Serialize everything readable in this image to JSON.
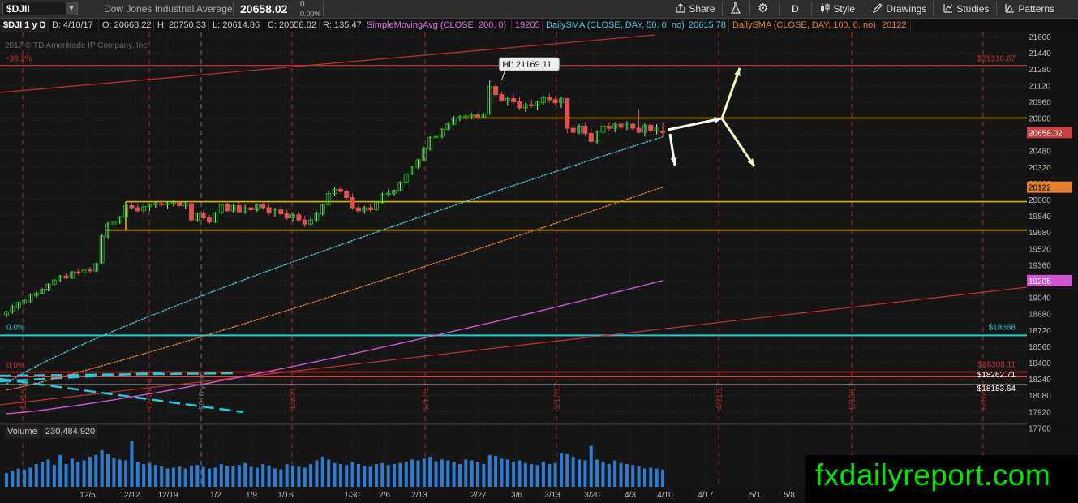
{
  "toolbar": {
    "symbol": "$DJII",
    "description": "Dow Jones Industrial Average",
    "last": "20658.02",
    "change": "0",
    "change_pct": "0.00%",
    "share": "Share",
    "period": "D",
    "style": "Style",
    "drawings": "Drawings",
    "studies": "Studies",
    "patterns": "Patterns"
  },
  "infobar": {
    "title": "$DJI 1 y D",
    "date": "D: 4/10/17",
    "open": "O: 20668.22",
    "high": "H: 20750.33",
    "low": "L: 20614.86",
    "close": "C: 20658.02",
    "range": "R: 135.47",
    "sma200": "SimpleMovingAvg (CLOSE, 200, 0)",
    "sma200_val": "19205",
    "sma50": "DailySMA (CLOSE, DAY, 50, 0, no)",
    "sma50_val": "20615.78",
    "sma100": "DailySMA (CLOSE, DAY, 100, 0, no)",
    "sma100_val": "20122"
  },
  "copyright": "2017 © TD Ameritrade IP Company, Inc.",
  "colors": {
    "up": "#00c000",
    "down": "#e05050",
    "sma50": "#46c8dc",
    "sma100": "#e08030",
    "sma200": "#d055d0",
    "support": "#e0b000",
    "cyan_level": "#20c8e0",
    "fib": "#c83030"
  },
  "price_axis": {
    "ticks": [
      "21600",
      "21440",
      "21280",
      "21120",
      "20960",
      "20800",
      "20640",
      "20480",
      "20320",
      "20160",
      "20000",
      "19840",
      "19680",
      "19520",
      "19360",
      "19200",
      "19040",
      "18880",
      "18720",
      "18560",
      "18400",
      "18240",
      "18080",
      "17920",
      "17760"
    ]
  },
  "badges": {
    "last": "20658.02",
    "sma100": "20122",
    "sma200": "19205"
  },
  "annotations": {
    "hi_callout": "Hi: 21169.11",
    "fib_top_left": "-38.2%",
    "fib_top_right": "$21316.67",
    "fib_zero_cyan": "0.0%",
    "cyan_right": "$18668",
    "fib_zero_red": "0.0%",
    "level_a": "$18262.71",
    "level_b": "$18183.64",
    "level_c": "$18308.11"
  },
  "x_axis": {
    "labels": [
      "12/5",
      "12/12",
      "12/19",
      "1/2",
      "1/9",
      "1/16",
      "1/30",
      "2/6",
      "2/13",
      "2/27",
      "3/6",
      "3/13",
      "3/20",
      "4/3",
      "4/10",
      "4/17",
      "5/1",
      "5/8"
    ]
  },
  "vertical_markers": [
    "12/1/16",
    "12/16/16",
    "2016 year",
    "1/20/17",
    "2/17/17",
    "3/17/17",
    "4/21/17",
    "5/19/17",
    "6/16/17"
  ],
  "volume": {
    "label": "Volume",
    "value": "230,484,920"
  },
  "watermark": "fxdailyreport.com",
  "chart_data": {
    "type": "candlestick",
    "title": "$DJI 1 y D",
    "ylim": [
      17700,
      21680
    ],
    "grid": true,
    "candles": [
      [
        18870,
        18910,
        18840,
        18900
      ],
      [
        18900,
        18970,
        18880,
        18950
      ],
      [
        18940,
        19000,
        18920,
        18990
      ],
      [
        18990,
        19030,
        18970,
        19010
      ],
      [
        19000,
        19080,
        18990,
        19060
      ],
      [
        19060,
        19100,
        19040,
        19080
      ],
      [
        19080,
        19130,
        19070,
        19120
      ],
      [
        19120,
        19180,
        19100,
        19170
      ],
      [
        19170,
        19220,
        19150,
        19210
      ],
      [
        19210,
        19260,
        19190,
        19250
      ],
      [
        19250,
        19280,
        19220,
        19230
      ],
      [
        19230,
        19300,
        19220,
        19290
      ],
      [
        19290,
        19320,
        19260,
        19280
      ],
      [
        19280,
        19320,
        19250,
        19310
      ],
      [
        19310,
        19340,
        19280,
        19300
      ],
      [
        19300,
        19380,
        19290,
        19370
      ],
      [
        19380,
        19660,
        19370,
        19640
      ],
      [
        19640,
        19780,
        19620,
        19760
      ],
      [
        19760,
        19790,
        19730,
        19780
      ],
      [
        19780,
        19840,
        19760,
        19830
      ],
      [
        19830,
        19960,
        19820,
        19940
      ],
      [
        19940,
        19970,
        19900,
        19920
      ],
      [
        19920,
        19950,
        19870,
        19890
      ],
      [
        19890,
        19960,
        19860,
        19930
      ],
      [
        19930,
        19960,
        19890,
        19950
      ],
      [
        19950,
        19980,
        19920,
        19960
      ],
      [
        19960,
        19990,
        19930,
        19950
      ],
      [
        19950,
        19980,
        19910,
        19960
      ],
      [
        19960,
        19990,
        19930,
        19970
      ],
      [
        19970,
        19980,
        19930,
        19940
      ],
      [
        19940,
        19980,
        19910,
        19960
      ],
      [
        19960,
        19980,
        19780,
        19800
      ],
      [
        19800,
        19870,
        19780,
        19860
      ],
      [
        19860,
        19890,
        19800,
        19820
      ],
      [
        19820,
        19850,
        19760,
        19780
      ],
      [
        19780,
        19880,
        19770,
        19870
      ],
      [
        19870,
        19960,
        19850,
        19950
      ],
      [
        19950,
        19970,
        19880,
        19890
      ],
      [
        19890,
        19960,
        19870,
        19940
      ],
      [
        19940,
        19970,
        19870,
        19880
      ],
      [
        19880,
        19950,
        19860,
        19920
      ],
      [
        19920,
        19950,
        19880,
        19900
      ],
      [
        19900,
        19960,
        19880,
        19950
      ],
      [
        19950,
        19980,
        19900,
        19920
      ],
      [
        19920,
        19950,
        19850,
        19870
      ],
      [
        19870,
        19920,
        19830,
        19900
      ],
      [
        19900,
        19930,
        19840,
        19860
      ],
      [
        19860,
        19900,
        19800,
        19820
      ],
      [
        19820,
        19870,
        19780,
        19850
      ],
      [
        19850,
        19880,
        19780,
        19800
      ],
      [
        19800,
        19840,
        19730,
        19760
      ],
      [
        19760,
        19830,
        19740,
        19800
      ],
      [
        19800,
        19880,
        19780,
        19860
      ],
      [
        19860,
        19960,
        19840,
        19950
      ],
      [
        19950,
        20080,
        19940,
        20060
      ],
      [
        20060,
        20120,
        20040,
        20100
      ],
      [
        20100,
        20130,
        20060,
        20080
      ],
      [
        20080,
        20100,
        20000,
        20020
      ],
      [
        20020,
        20060,
        19900,
        19920
      ],
      [
        19920,
        19960,
        19860,
        19890
      ],
      [
        19890,
        19940,
        19860,
        19920
      ],
      [
        19920,
        19960,
        19880,
        19900
      ],
      [
        19900,
        19980,
        19890,
        19970
      ],
      [
        19970,
        20070,
        19960,
        20050
      ],
      [
        20050,
        20100,
        20030,
        20060
      ],
      [
        20060,
        20100,
        20040,
        20090
      ],
      [
        20090,
        20180,
        20080,
        20170
      ],
      [
        20170,
        20260,
        20160,
        20250
      ],
      [
        20250,
        20330,
        20240,
        20320
      ],
      [
        20320,
        20400,
        20300,
        20390
      ],
      [
        20390,
        20520,
        20380,
        20500
      ],
      [
        20500,
        20620,
        20480,
        20610
      ],
      [
        20610,
        20650,
        20580,
        20620
      ],
      [
        20620,
        20700,
        20600,
        20690
      ],
      [
        20690,
        20760,
        20680,
        20740
      ],
      [
        20740,
        20820,
        20730,
        20800
      ],
      [
        20800,
        20830,
        20770,
        20810
      ],
      [
        20810,
        20840,
        20780,
        20820
      ],
      [
        20820,
        20850,
        20790,
        20830
      ],
      [
        20830,
        20850,
        20790,
        20810
      ],
      [
        20810,
        20850,
        20800,
        20840
      ],
      [
        20840,
        21169,
        20830,
        21110
      ],
      [
        21110,
        21140,
        21010,
        21030
      ],
      [
        21030,
        21060,
        20960,
        20970
      ],
      [
        20970,
        21010,
        20920,
        20990
      ],
      [
        20990,
        21030,
        20940,
        20960
      ],
      [
        20960,
        21010,
        20880,
        20900
      ],
      [
        20900,
        20950,
        20860,
        20930
      ],
      [
        20930,
        20980,
        20900,
        20920
      ],
      [
        20920,
        20970,
        20880,
        20950
      ],
      [
        20950,
        21020,
        20930,
        21000
      ],
      [
        21000,
        21040,
        20950,
        20980
      ],
      [
        20980,
        21010,
        20930,
        20950
      ],
      [
        20950,
        21010,
        20900,
        20990
      ],
      [
        20990,
        21000,
        20650,
        20700
      ],
      [
        20700,
        20740,
        20600,
        20660
      ],
      [
        20660,
        20740,
        20640,
        20720
      ],
      [
        20720,
        20760,
        20620,
        20650
      ],
      [
        20650,
        20700,
        20540,
        20570
      ],
      [
        20570,
        20680,
        20550,
        20660
      ],
      [
        20660,
        20740,
        20640,
        20720
      ],
      [
        20720,
        20760,
        20670,
        20700
      ],
      [
        20700,
        20760,
        20660,
        20740
      ],
      [
        20740,
        20770,
        20690,
        20710
      ],
      [
        20710,
        20770,
        20680,
        20740
      ],
      [
        20740,
        20760,
        20680,
        20700
      ],
      [
        20700,
        20890,
        20650,
        20660
      ],
      [
        20660,
        20750,
        20620,
        20730
      ],
      [
        20730,
        20750,
        20660,
        20680
      ],
      [
        20680,
        20740,
        20640,
        20700
      ],
      [
        20668,
        20750,
        20615,
        20658
      ]
    ],
    "sma50": {
      "name": "DailySMA (CLOSE, DAY, 50, 0, no)",
      "last": 20615.78
    },
    "sma100": {
      "name": "DailySMA (CLOSE, DAY, 100, 0, no)",
      "last": 20122
    },
    "sma200": {
      "name": "SimpleMovingAvg (CLOSE, 200, 0)",
      "last": 19205
    },
    "horizontal_levels": {
      "resistance_fib": 21316.67,
      "resistance": 20800,
      "support_upper": 19980,
      "support_lower": 19700,
      "cyan": 18668,
      "red_a": 18308.11,
      "red_b": 18262.71,
      "red_c": 18183.64
    },
    "high_annotation": 21169.11
  }
}
